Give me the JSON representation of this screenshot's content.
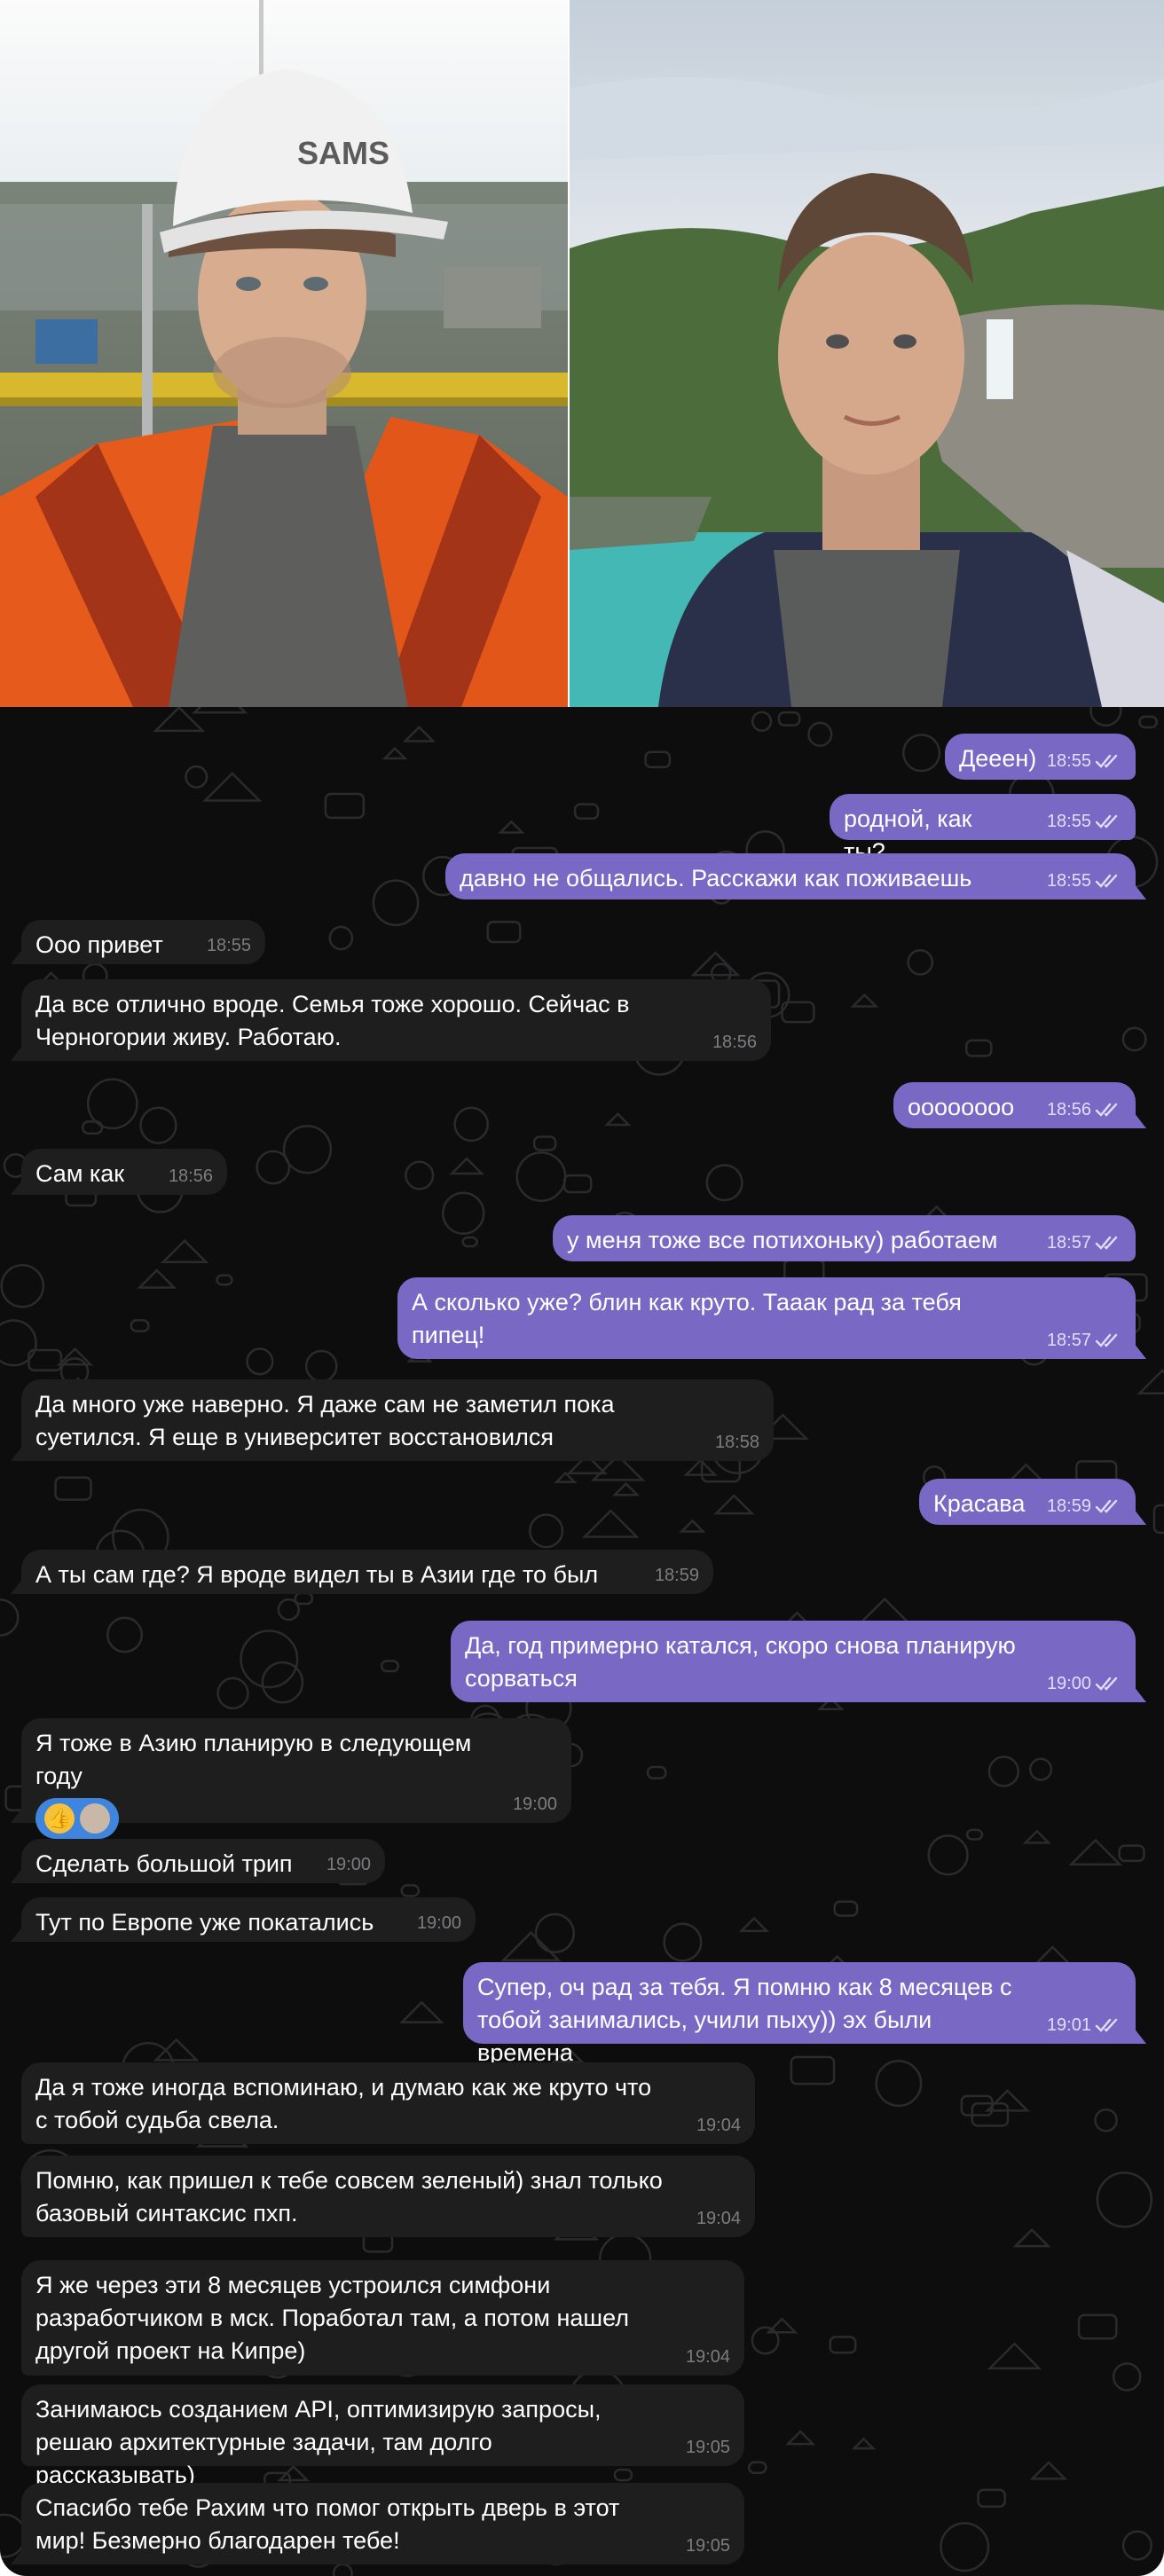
{
  "photos": {
    "left_helmet_logo": "SAMS"
  },
  "colors": {
    "chat_background": "#0d0d0d",
    "incoming_bubble": "#1e1e1f",
    "outgoing_bubble": "#7a68c5",
    "reaction_pill": "#3f84dd"
  },
  "read_receipt_icon": "double-check-icon",
  "messages": [
    {
      "dir": "out",
      "text": "Дееен)",
      "time": "18:55",
      "read": true
    },
    {
      "dir": "out",
      "text": "родной, как ты?",
      "time": "18:55",
      "read": true
    },
    {
      "dir": "out",
      "text": "давно не общались. Расскажи как поживаешь",
      "time": "18:55",
      "read": true
    },
    {
      "dir": "in",
      "text": "Ооо привет",
      "time": "18:55"
    },
    {
      "dir": "in",
      "text": "Да все отлично вроде. Семья тоже хорошо. Сейчас в Черногории живу. Работаю.",
      "time": "18:56"
    },
    {
      "dir": "out",
      "text": "оооооооо",
      "time": "18:56",
      "read": true
    },
    {
      "dir": "in",
      "text": "Сам как",
      "time": "18:56"
    },
    {
      "dir": "out",
      "text": "у меня тоже все потихоньку) работаем",
      "time": "18:57",
      "read": true
    },
    {
      "dir": "out",
      "text": "А сколько уже? блин как круто. Тааак рад за тебя пипец!",
      "time": "18:57",
      "read": true
    },
    {
      "dir": "in",
      "text": "Да много уже наверно. Я даже сам не заметил пока суетился. Я еще в университет восстановился",
      "time": "18:58"
    },
    {
      "dir": "out",
      "text": "Красава",
      "time": "18:59",
      "read": true
    },
    {
      "dir": "in",
      "text": "А ты сам где? Я вроде видел ты в Азии где то был",
      "time": "18:59"
    },
    {
      "dir": "out",
      "text": "Да, год примерно катался, скоро снова планирую сорваться",
      "time": "19:00",
      "read": true
    },
    {
      "dir": "in",
      "text": "Я тоже в Азию планирую в следующем году",
      "time": "19:00",
      "reactions": [
        "thumbs-up-emoji",
        "avatar-reaction"
      ]
    },
    {
      "dir": "in",
      "text": "Сделать большой трип",
      "time": "19:00"
    },
    {
      "dir": "in",
      "text": "Тут по Европе уже покатались",
      "time": "19:00"
    },
    {
      "dir": "out",
      "text": "Супер, оч рад за тебя. Я помню как 8 месяцев с тобой занимались, учили пыху)) эх были времена",
      "time": "19:01",
      "read": true
    },
    {
      "dir": "in",
      "text": "Да я тоже иногда вспоминаю, и думаю как же круто что с тобой судьба свела.",
      "time": "19:04"
    },
    {
      "dir": "in",
      "text": "Помню, как пришел к тебе совсем зеленый) знал только базовый синтаксис пхп.",
      "time": "19:04"
    },
    {
      "dir": "in",
      "text": "Я же через эти 8 месяцев устроился симфони разработчиком в мск. Поработал там, а потом нашел другой проект на Кипре)",
      "time": "19:04"
    },
    {
      "dir": "in",
      "text": "Занимаюсь созданием API, оптимизирую запросы, решаю архитектурные задачи, там долго рассказывать)",
      "time": "19:05"
    },
    {
      "dir": "in",
      "text": "Спасибо тебе Рахим что помог открыть дверь в этот мир! Безмерно благодарен тебе!",
      "time": "19:05"
    }
  ]
}
